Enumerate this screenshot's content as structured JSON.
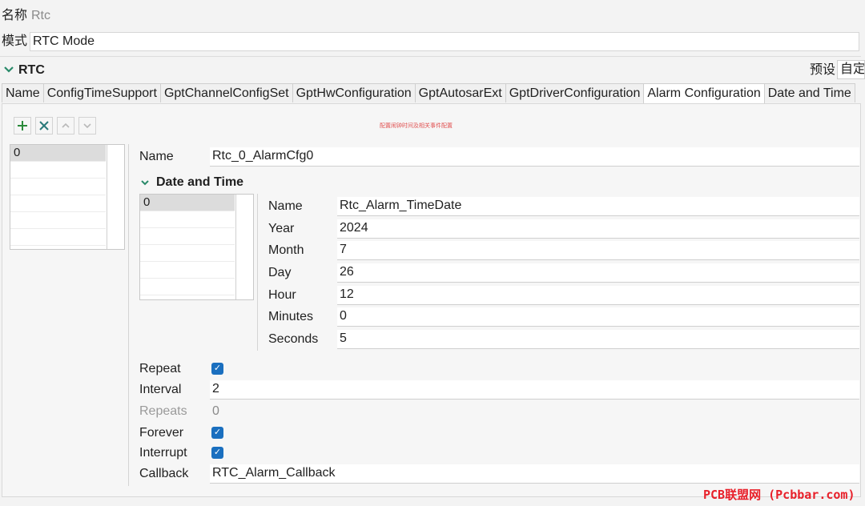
{
  "header": {
    "name_label": "名称",
    "name_value": "Rtc",
    "mode_label": "模式",
    "mode_value": "RTC Mode"
  },
  "section": {
    "title": "RTC",
    "preset_label": "预设",
    "preset_value": "自定"
  },
  "tabs": [
    {
      "label": "Name"
    },
    {
      "label": "ConfigTimeSupport"
    },
    {
      "label": "GptChannelConfigSet"
    },
    {
      "label": "GptHwConfiguration"
    },
    {
      "label": "GptAutosarExt"
    },
    {
      "label": "GptDriverConfiguration"
    },
    {
      "label": "Alarm Configuration",
      "active": true
    },
    {
      "label": "Date and Time"
    }
  ],
  "toolbar": {
    "hint": "配置闹钟时间及相关事件配置",
    "add_icon": "plus-icon",
    "delete_icon": "close-icon",
    "up_icon": "chevron-up-icon",
    "down_icon": "chevron-down-icon"
  },
  "alarm_list": {
    "items": [
      "0"
    ]
  },
  "alarm": {
    "name_label": "Name",
    "name_value": "Rtc_0_AlarmCfg0",
    "datetime_title": "Date and Time",
    "dt_list": {
      "items": [
        "0"
      ]
    },
    "dt": {
      "name_label": "Name",
      "name_value": "Rtc_Alarm_TimeDate",
      "year_label": "Year",
      "year_value": "2024",
      "month_label": "Month",
      "month_value": "7",
      "day_label": "Day",
      "day_value": "26",
      "hour_label": "Hour",
      "hour_value": "12",
      "minutes_label": "Minutes",
      "minutes_value": "0",
      "seconds_label": "Seconds",
      "seconds_value": "5"
    },
    "repeat_label": "Repeat",
    "repeat_checked": true,
    "interval_label": "Interval",
    "interval_value": "2",
    "repeats_label": "Repeats",
    "repeats_value": "0",
    "forever_label": "Forever",
    "forever_checked": true,
    "interrupt_label": "Interrupt",
    "interrupt_checked": true,
    "callback_label": "Callback",
    "callback_value": "RTC_Alarm_Callback"
  },
  "watermark": "PCB联盟网 (Pcbbar.com)",
  "colors": {
    "accent": "#1a6fbf",
    "hint": "#e05050",
    "watermark": "#e8202a",
    "chevron": "#2a8a6a"
  }
}
